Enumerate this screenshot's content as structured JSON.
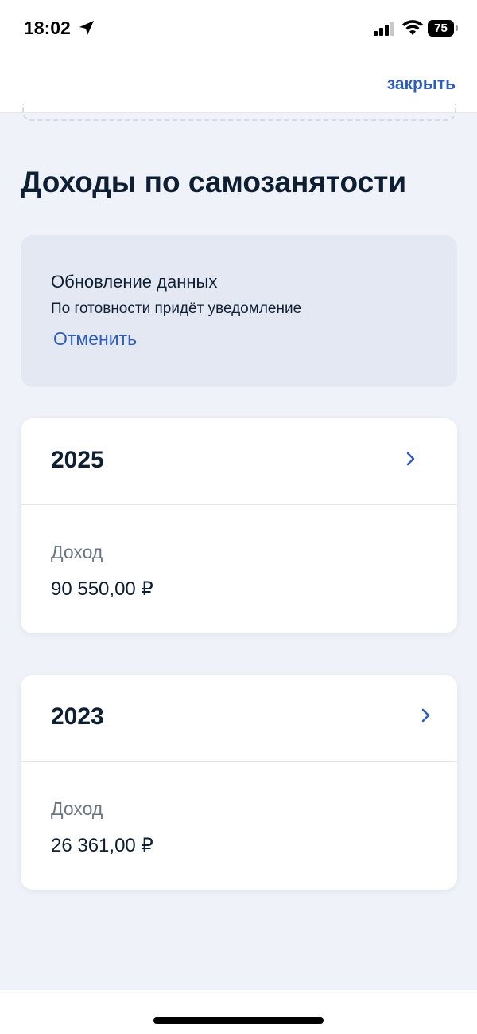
{
  "status_bar": {
    "time": "18:02",
    "battery": "75",
    "icons": [
      "location-arrow-icon",
      "signal-icon",
      "wifi-icon",
      "battery-icon"
    ]
  },
  "nav": {
    "close_label": "закрыть"
  },
  "page": {
    "title": "Доходы по самозанятости"
  },
  "banner": {
    "title": "Обновление данных",
    "text": "По готовности придёт уведомление",
    "cancel_label": "Отменить"
  },
  "cards": [
    {
      "year": "2025",
      "label": "Доход",
      "value": "90 550,00 ₽"
    },
    {
      "year": "2023",
      "label": "Доход",
      "value": "26 361,00 ₽"
    }
  ],
  "colors": {
    "accent": "#2f5dbc",
    "background": "#eff2f8",
    "banner": "#e3e8f3",
    "text": "#0f1f33",
    "muted": "#6b7685"
  }
}
